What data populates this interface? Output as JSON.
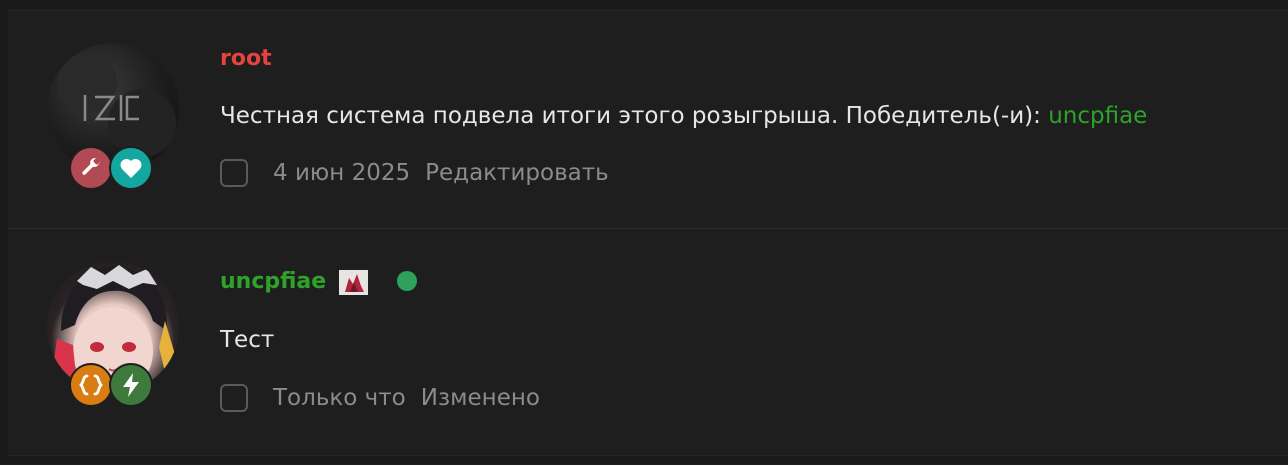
{
  "posts": [
    {
      "author": "root",
      "author_color": "#e5433e",
      "avatar": "root-logo",
      "badges": [
        "wrench-icon",
        "heart-icon"
      ],
      "text": "Честная система подвела итоги этого розыгрыша. Победитель(-и): ",
      "winner": "uncpfiae",
      "date": "4 июн 2025",
      "action": "Редактировать"
    },
    {
      "author": "uncpfiae",
      "author_color": "#2ea32a",
      "avatar": "anime-girl",
      "badges": [
        "braces-icon",
        "bolt-icon"
      ],
      "online": true,
      "text": "Тест",
      "date": "Только что",
      "action": "Изменено"
    }
  ],
  "colors": {
    "background": "#1e1e1e",
    "text": "#e6e6e6",
    "meta": "#8b8b8b",
    "link_green": "#2ea32a",
    "online": "#2fa15c"
  }
}
